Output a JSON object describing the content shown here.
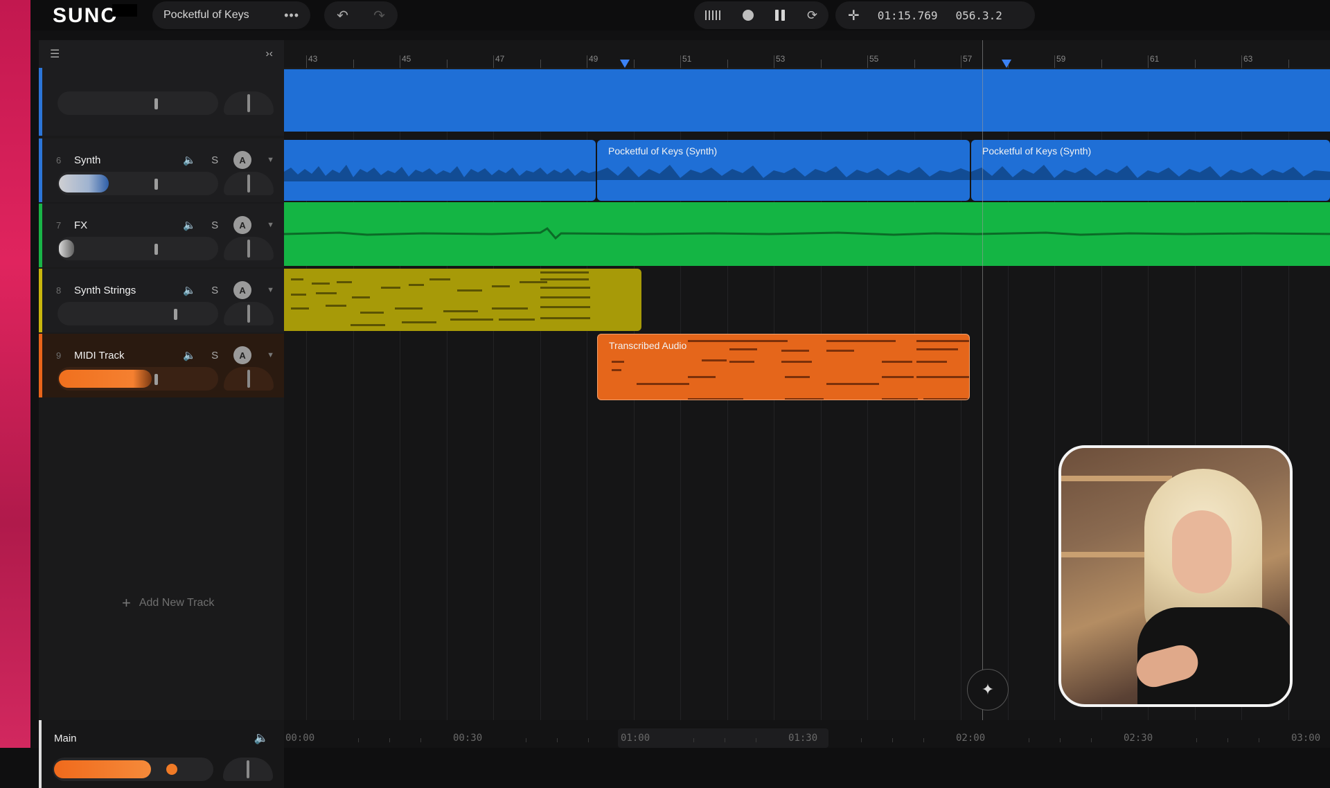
{
  "app": {
    "logo": "SUNO",
    "project_name": "Pocketful of Keys",
    "more": "•••"
  },
  "header": {
    "undo_icon": "undo-icon",
    "redo_icon": "redo-icon",
    "time": "01:15.769",
    "bars": "056.3.2"
  },
  "sidebar": {
    "tracks": [
      {
        "number": "",
        "name": "",
        "color": "#2b75d8"
      },
      {
        "number": "6",
        "name": "Synth",
        "color": "#2b75d8",
        "solo": "S",
        "auto": "A",
        "level": 0.3
      },
      {
        "number": "7",
        "name": "FX",
        "color": "#19b447",
        "solo": "S",
        "auto": "A",
        "level": 0.08
      },
      {
        "number": "8",
        "name": "Synth Strings",
        "color": "#c9b60e",
        "solo": "S",
        "auto": "A",
        "level": 0.0
      },
      {
        "number": "9",
        "name": "MIDI Track",
        "color": "#e8641a",
        "solo": "S",
        "auto": "A",
        "level": 0.48
      }
    ],
    "add_track": "Add New Track",
    "main": {
      "name": "Main",
      "level": 0.62
    }
  },
  "ruler": {
    "labels": [
      "43",
      "45",
      "47",
      "49",
      "51",
      "53",
      "55",
      "57",
      "59",
      "61",
      "63"
    ]
  },
  "clips": {
    "synth_a": "Pocketful of Keys (Synth)",
    "synth_b": "Pocketful of Keys (Synth)",
    "midi": "Transcribed Audio"
  },
  "bottom_ruler": {
    "labels": [
      "00:00",
      "00:30",
      "01:00",
      "01:30",
      "02:00",
      "02:30",
      "03:00"
    ]
  },
  "colors": {
    "blue": "#1f6fd6",
    "green": "#14b544",
    "yellow": "#a79a08",
    "orange": "#e5661b"
  }
}
